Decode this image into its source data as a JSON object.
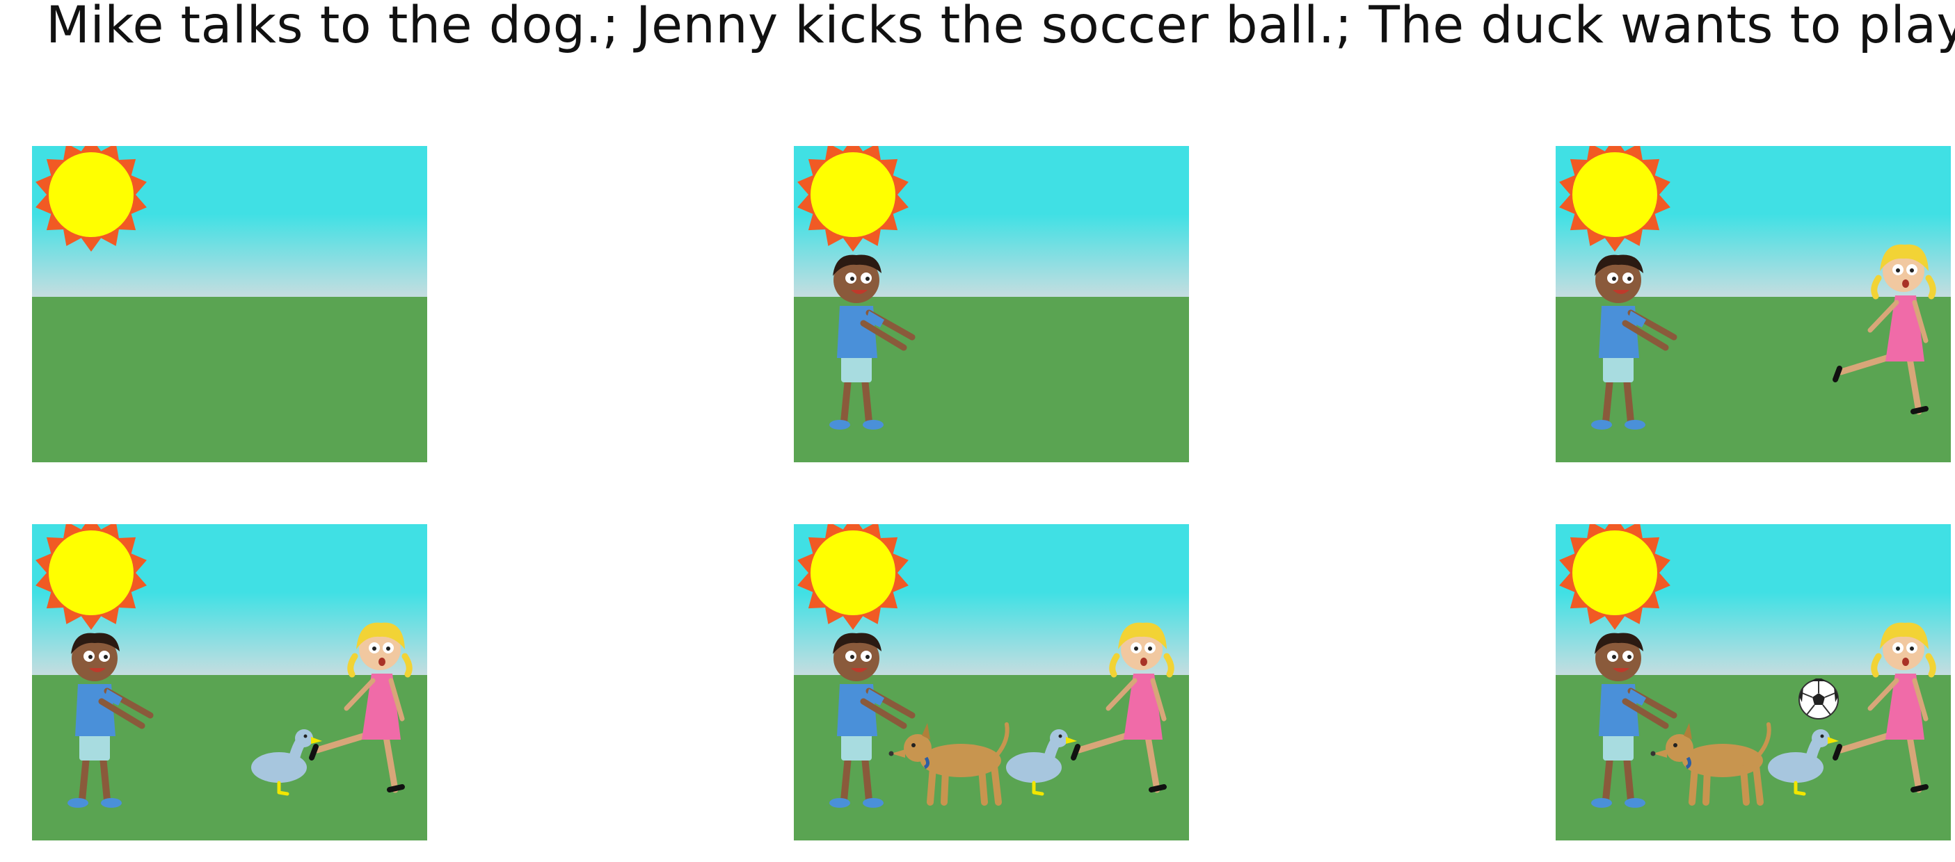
{
  "caption": "Mike talks to the dog.; Jenny kicks the soccer ball.; The duck wants to play.",
  "colors": {
    "sky_top": "#40E0E4",
    "sky_bottom": "#C6DDE0",
    "grass": "#5AA452",
    "sun_core": "#FFFF00",
    "sun_rays": "#F15A24"
  },
  "panels": [
    {
      "scene": [
        "sun"
      ]
    },
    {
      "scene": [
        "sun",
        "boy"
      ]
    },
    {
      "scene": [
        "sun",
        "boy",
        "girl"
      ]
    },
    {
      "scene": [
        "sun",
        "boy",
        "girl",
        "duck"
      ]
    },
    {
      "scene": [
        "sun",
        "boy",
        "girl",
        "duck",
        "dog"
      ]
    },
    {
      "scene": [
        "sun",
        "boy",
        "girl",
        "duck",
        "dog",
        "soccer-ball"
      ]
    }
  ]
}
